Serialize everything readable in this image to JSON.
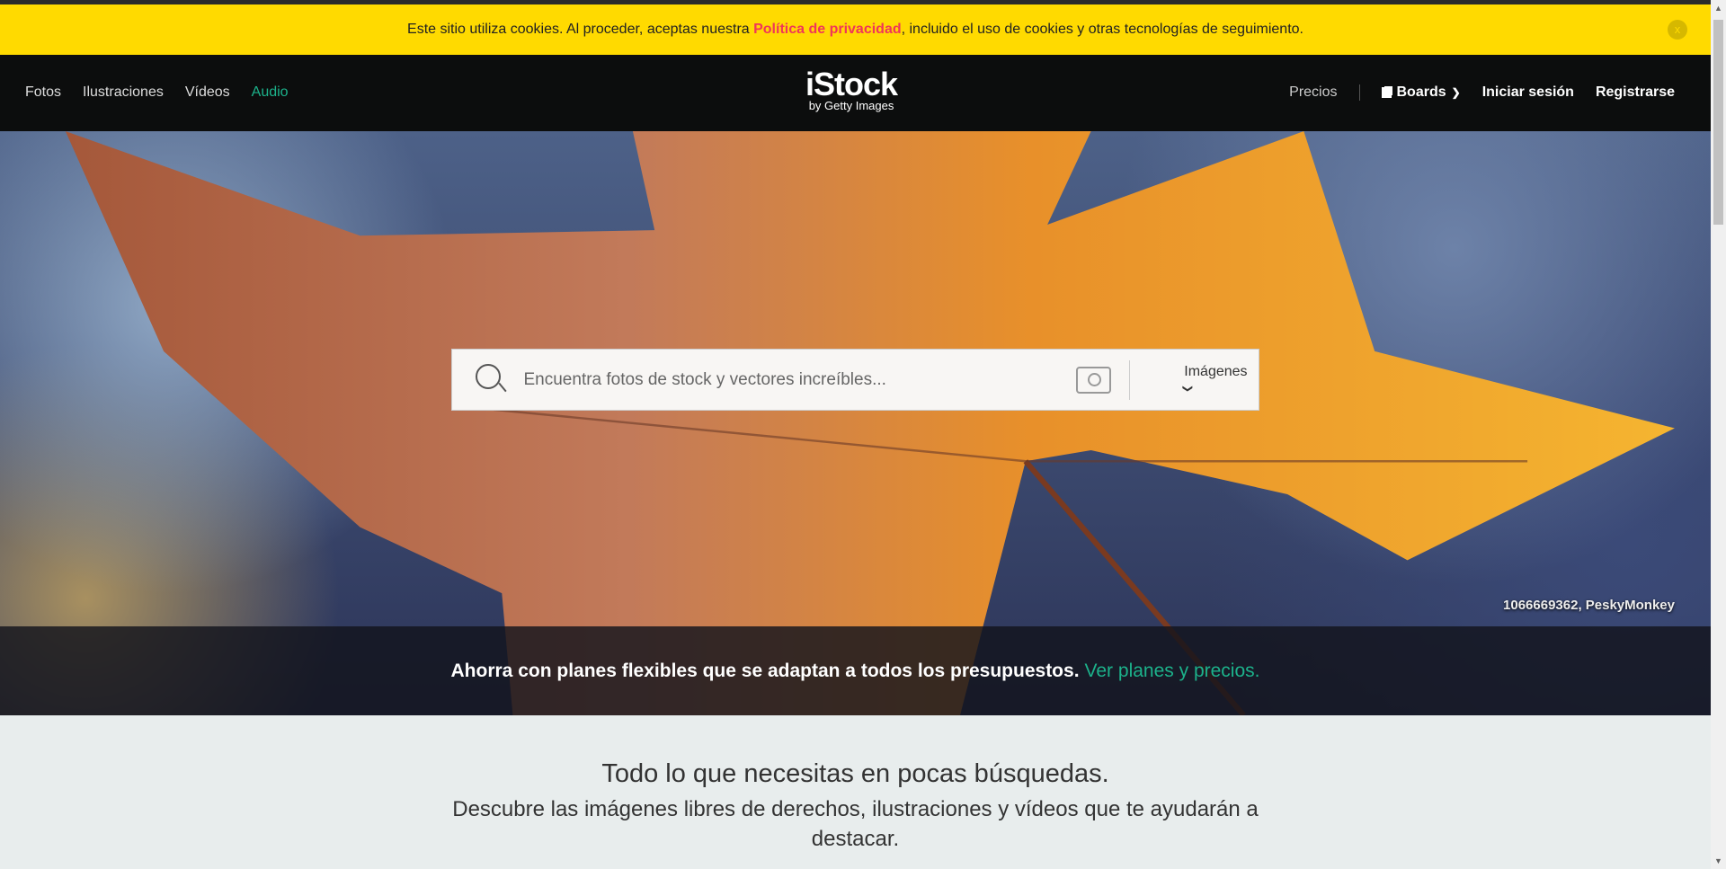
{
  "cookie": {
    "text_before": "Este sitio utiliza cookies. Al proceder, aceptas nuestra ",
    "link": "Política de privacidad",
    "text_after": ", incluido el uso de cookies y otras tecnologías de seguimiento.",
    "close": "x"
  },
  "nav": {
    "left": [
      "Fotos",
      "Ilustraciones",
      "Vídeos",
      "Audio"
    ],
    "active_color": "#1cb28b",
    "logo": "iStock",
    "logo_sub": "by Getty Images",
    "prices": "Precios",
    "boards": "Boards",
    "login": "Iniciar sesión",
    "signup": "Registrarse"
  },
  "hero": {
    "credit": "1066669362, PeskyMonkey",
    "search_placeholder": "Encuentra fotos de stock y vectores increíbles...",
    "search_type": "Imágenes",
    "promo_text": "Ahorra con planes flexibles que se adaptan a todos los presupuestos.",
    "promo_link": "Ver planes y precios."
  },
  "lower": {
    "title": "Todo lo que necesitas en pocas búsquedas.",
    "subtitle": "Descubre las imágenes libres de derechos, ilustraciones y vídeos que te ayudarán a destacar."
  },
  "colors": {
    "cookie_bg": "#ffda00",
    "nav_bg": "#0c0d0d",
    "accent": "#1cb28b",
    "link_red": "#f0355a"
  }
}
